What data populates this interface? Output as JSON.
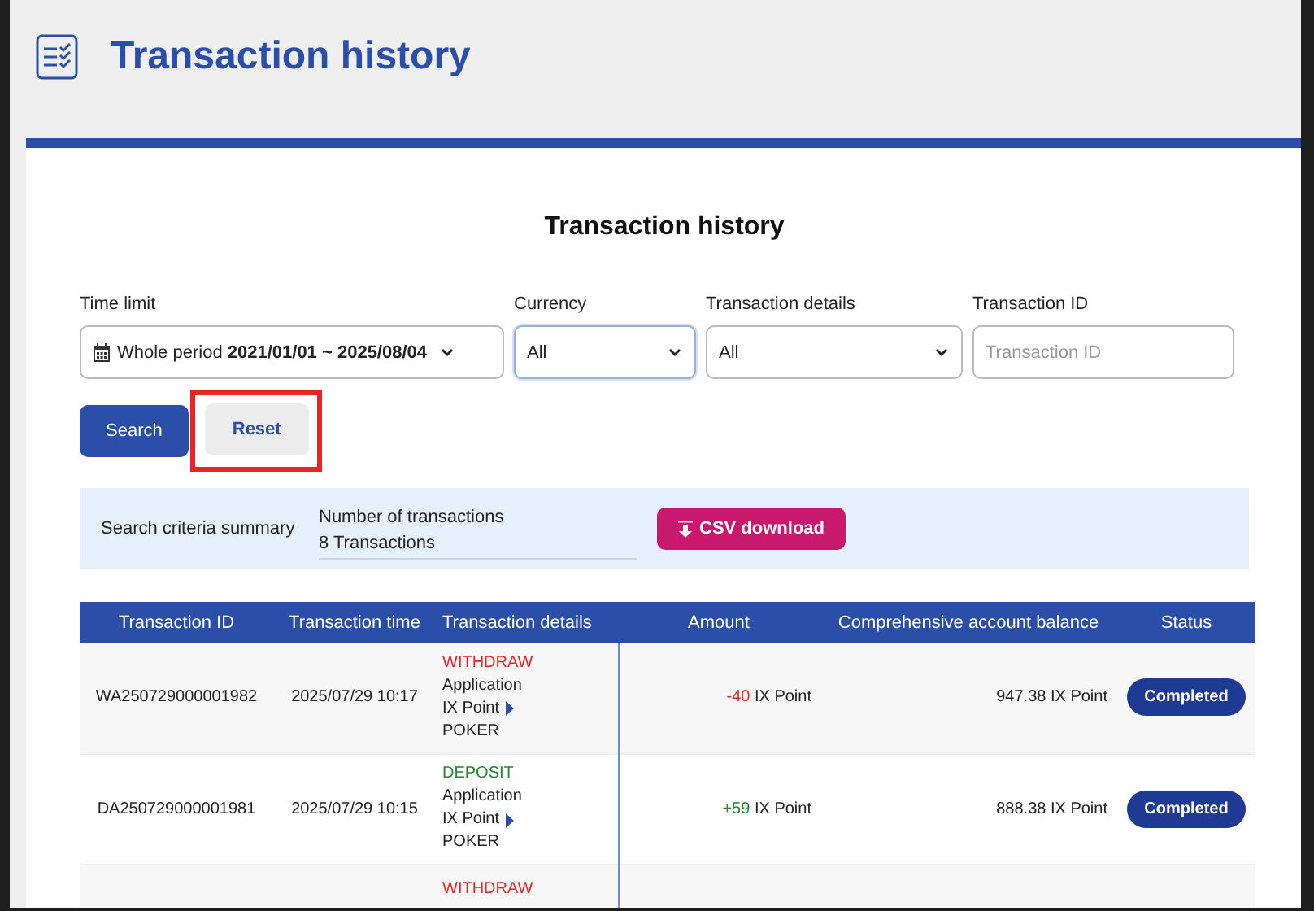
{
  "page": {
    "title": "Transaction history"
  },
  "card": {
    "title": "Transaction history"
  },
  "filters": [
    {
      "kind": "period",
      "label": "Time limit",
      "prefix": "Whole period",
      "value": "2021/01/01 ~ 2025/08/04",
      "focused": false
    },
    {
      "kind": "select",
      "label": "Currency",
      "value": "All",
      "focused": true
    },
    {
      "kind": "select",
      "label": "Transaction details",
      "value": "All",
      "focused": false
    },
    {
      "kind": "text",
      "label": "Transaction ID",
      "placeholder": "Transaction ID",
      "focused": false
    }
  ],
  "buttons": [
    {
      "kind": "primary",
      "label": "Search",
      "highlighted": false
    },
    {
      "kind": "secondary",
      "label": "Reset",
      "highlighted": true
    }
  ],
  "summary": {
    "label": "Search criteria summary",
    "count_label": "Number of transactions",
    "count": "8 Transactions",
    "download": "CSV download"
  },
  "table": {
    "columns": [
      "Transaction ID",
      "Transaction time",
      "Transaction details",
      "Amount",
      "Comprehensive account balance",
      "Status"
    ],
    "rows": [
      {
        "id": "WA250729000001982",
        "time": "2025/07/29 10:17",
        "type": "WITHDRAW",
        "kind": "withdraw",
        "details": [
          "Application",
          "IX Point",
          "POKER"
        ],
        "amount": "-40",
        "unit": "IX Point",
        "balance": "947.38 IX Point",
        "status": "Completed"
      },
      {
        "id": "DA250729000001981",
        "time": "2025/07/29 10:15",
        "type": "DEPOSIT",
        "kind": "deposit",
        "details": [
          "Application",
          "IX Point",
          "POKER"
        ],
        "amount": "+59",
        "unit": "IX Point",
        "balance": "888.38 IX Point",
        "status": "Completed"
      },
      {
        "type": "WITHDRAW",
        "kind": "withdraw"
      }
    ]
  }
}
